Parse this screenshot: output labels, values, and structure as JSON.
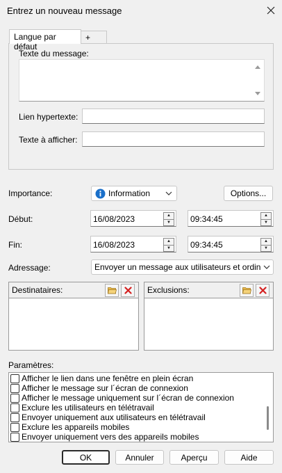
{
  "window": {
    "title": "Entrez un nouveau message"
  },
  "tabs": [
    {
      "label": "Langue par défaut"
    },
    {
      "label": "+"
    }
  ],
  "message": {
    "text_label": "Texte du message:",
    "text_value": "",
    "link_label": "Lien hypertexte:",
    "link_value": "",
    "display_label": "Texte à afficher:",
    "display_value": ""
  },
  "importance": {
    "label": "Importance:",
    "value": "Information",
    "options_button": "Options..."
  },
  "start": {
    "label": "Début:",
    "date": "16/08/2023",
    "time": "09:34:45"
  },
  "end": {
    "label": "Fin:",
    "date": "16/08/2023",
    "time": "09:34:45"
  },
  "addressing": {
    "label": "Adressage:",
    "value": "Envoyer un message aux utilisateurs et ordinateur"
  },
  "recipients": {
    "label": "Destinataires:"
  },
  "exclusions": {
    "label": "Exclusions:"
  },
  "parameters": {
    "label": "Paramètres:",
    "items": [
      {
        "label": "Afficher le lien dans une fenêtre en plein écran",
        "checked": false
      },
      {
        "label": "Afficher le message sur l´écran de connexion",
        "checked": false
      },
      {
        "label": "Afficher le message uniquement sur l´écran de connexion",
        "checked": false
      },
      {
        "label": "Exclure les utilisateurs en télétravail",
        "checked": false
      },
      {
        "label": "Envoyer uniquement aux utilisateurs en télétravail",
        "checked": false
      },
      {
        "label": "Exclure les appareils mobiles",
        "checked": false
      },
      {
        "label": "Envoyer uniquement vers des appareils mobiles",
        "checked": false
      }
    ]
  },
  "buttons": {
    "ok": "OK",
    "cancel": "Annuler",
    "preview": "Aperçu",
    "help": "Aide"
  },
  "colors": {
    "info_icon": "#1a6fc9",
    "delete_icon": "#d42020",
    "folder_icon": "#e8b84a"
  }
}
